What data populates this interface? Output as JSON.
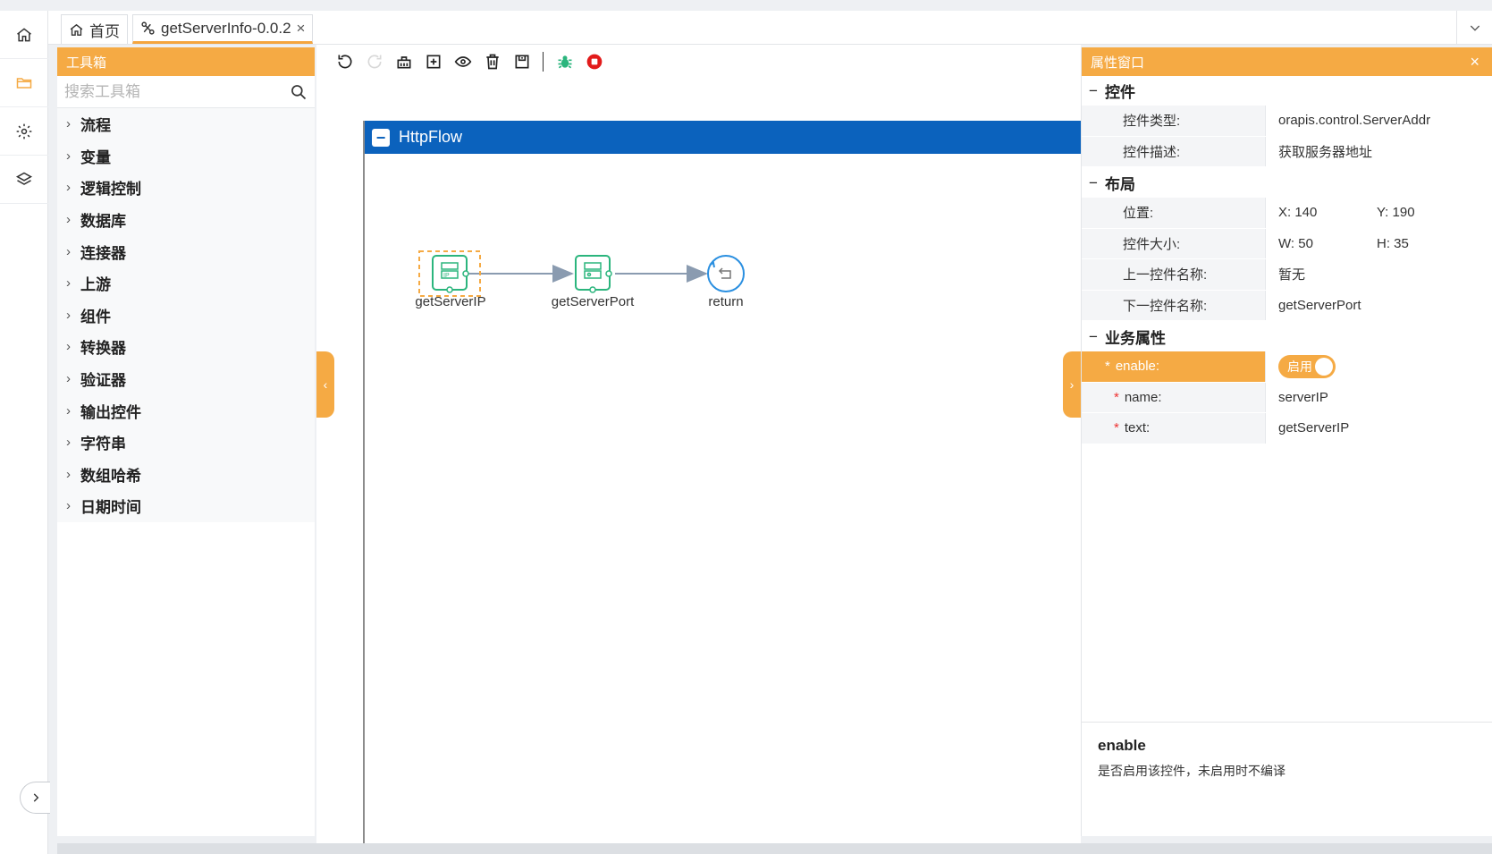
{
  "tabs": [
    {
      "label": "首页",
      "icon": "home-icon"
    },
    {
      "label": "getServerInfo-0.0.2",
      "icon": "flow-icon",
      "close": "×"
    }
  ],
  "toolbox": {
    "title": "工具箱",
    "search_placeholder": "搜索工具箱",
    "items": [
      "流程",
      "变量",
      "逻辑控制",
      "数据库",
      "连接器",
      "上游",
      "组件",
      "转换器",
      "验证器",
      "输出控件",
      "字符串",
      "数组哈希",
      "日期时间"
    ]
  },
  "toolbar": {
    "buttons": [
      "undo-icon",
      "redo-icon",
      "clear-icon",
      "fit-icon",
      "preview-icon",
      "delete-icon",
      "save-icon",
      "debug-icon",
      "stop-icon"
    ]
  },
  "flow": {
    "title": "HttpFlow",
    "nodes": [
      {
        "label": "getServerIP",
        "icon": "server-ip-icon"
      },
      {
        "label": "getServerPort",
        "icon": "server-port-icon"
      },
      {
        "label": "return",
        "icon": "return-icon"
      }
    ]
  },
  "props": {
    "title": "属性窗口",
    "close": "×",
    "sections": {
      "control": {
        "title": "控件",
        "type_key": "控件类型:",
        "type_val": "orapis.control.ServerAddr",
        "desc_key": "控件描述:",
        "desc_val": "获取服务器地址"
      },
      "layout": {
        "title": "布局",
        "pos_key": "位置:",
        "pos_x": "X: 140",
        "pos_y": "Y: 190",
        "size_key": "控件大小:",
        "size_w": "W: 50",
        "size_h": "H: 35",
        "prev_key": "上一控件名称:",
        "prev_val": "暂无",
        "next_key": "下一控件名称:",
        "next_val": "getServerPort"
      },
      "business": {
        "title": "业务属性",
        "enable_key": "enable:",
        "enable_val": "启用",
        "name_key": "name:",
        "name_val": "serverIP",
        "text_key": "text:",
        "text_val": "getServerIP"
      }
    },
    "help": {
      "title": "enable",
      "text": "是否启用该控件，未启用时不编译"
    }
  },
  "colors": {
    "accent": "#f5aa44",
    "flow_header": "#0b62bd",
    "node_green": "#2bb57d",
    "node_blue": "#2a8fe0"
  }
}
